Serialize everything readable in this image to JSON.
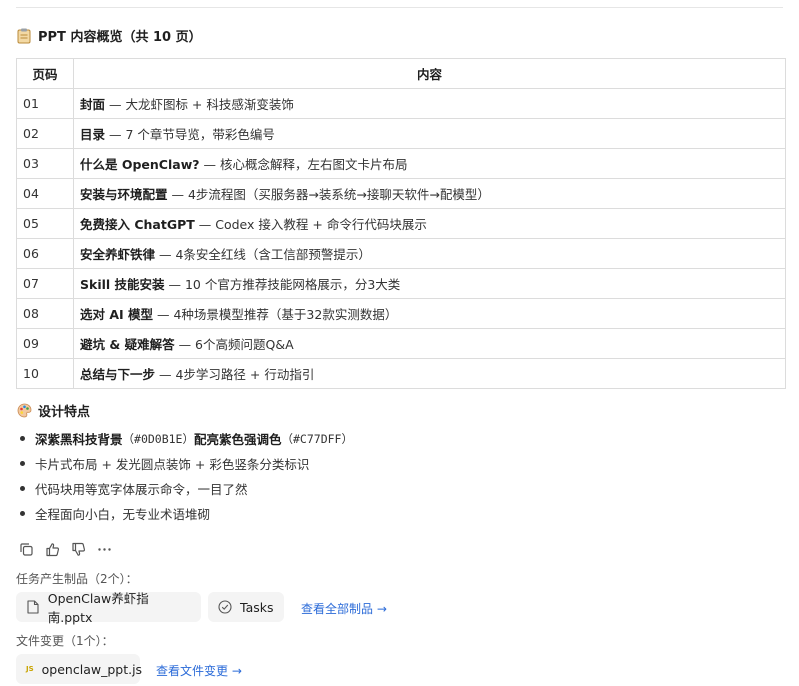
{
  "overview": {
    "title": "PPT 内容概览（共 10 页）",
    "columns": {
      "page": "页码",
      "content": "内容"
    },
    "rows": [
      {
        "page": "01",
        "bold": "封面",
        "rest": " — 大龙虾图标 + 科技感渐变装饰"
      },
      {
        "page": "02",
        "bold": "目录",
        "rest": " — 7 个章节导览，带彩色编号"
      },
      {
        "page": "03",
        "bold": "什么是 OpenClaw?",
        "rest": " — 核心概念解释，左右图文卡片布局"
      },
      {
        "page": "04",
        "bold": "安装与环境配置",
        "rest": " — 4步流程图（买服务器→装系统→接聊天软件→配模型）"
      },
      {
        "page": "05",
        "bold": "免费接入 ChatGPT",
        "rest": " — Codex 接入教程 + 命令行代码块展示"
      },
      {
        "page": "06",
        "bold": "安全养虾铁律",
        "rest": " — 4条安全红线（含工信部预警提示）"
      },
      {
        "page": "07",
        "bold": "Skill 技能安装",
        "rest": " — 10 个官方推荐技能网格展示，分3大类"
      },
      {
        "page": "08",
        "bold": "选对 AI 模型",
        "rest": " — 4种场景模型推荐（基于32款实测数据）"
      },
      {
        "page": "09",
        "bold": "避坑 & 疑难解答",
        "rest": " — 6个高频问题Q&A"
      },
      {
        "page": "10",
        "bold": "总结与下一步",
        "rest": " — 4步学习路径 + 行动指引"
      }
    ]
  },
  "design": {
    "title": "设计特点",
    "item1": {
      "bold1": "深紫黑科技背景",
      "code1": "（#0D0B1E）",
      "bold2": "配亮紫色强调色",
      "code2": "（#C77DFF）"
    },
    "items": [
      "卡片式布局 + 发光圆点装饰 + 彩色竖条分类标识",
      "代码块用等宽字体展示命令，一目了然",
      "全程面向小白，无专业术语堆砌"
    ]
  },
  "artifacts": {
    "label": "任务产生制品（2个）：",
    "file": "OpenClaw养虾指南.pptx",
    "tasks": "Tasks",
    "view_all": "查看全部制品 →"
  },
  "changes": {
    "label": "文件变更（1个）：",
    "file": "openclaw_ppt.js",
    "js_badge": "JS",
    "view_changes": "查看文件变更 →"
  },
  "icons": {
    "overview": "clipboard-icon",
    "design": "palette-icon",
    "actions": [
      "copy-icon",
      "thumbs-up-icon",
      "thumbs-down-icon",
      "more-icon"
    ],
    "pptx": "file-icon",
    "tasks": "check-circle-icon"
  },
  "colors": {
    "link": "#2b6bd8",
    "chip_bg": "#f4f4f4",
    "border": "#dcdcdc"
  }
}
